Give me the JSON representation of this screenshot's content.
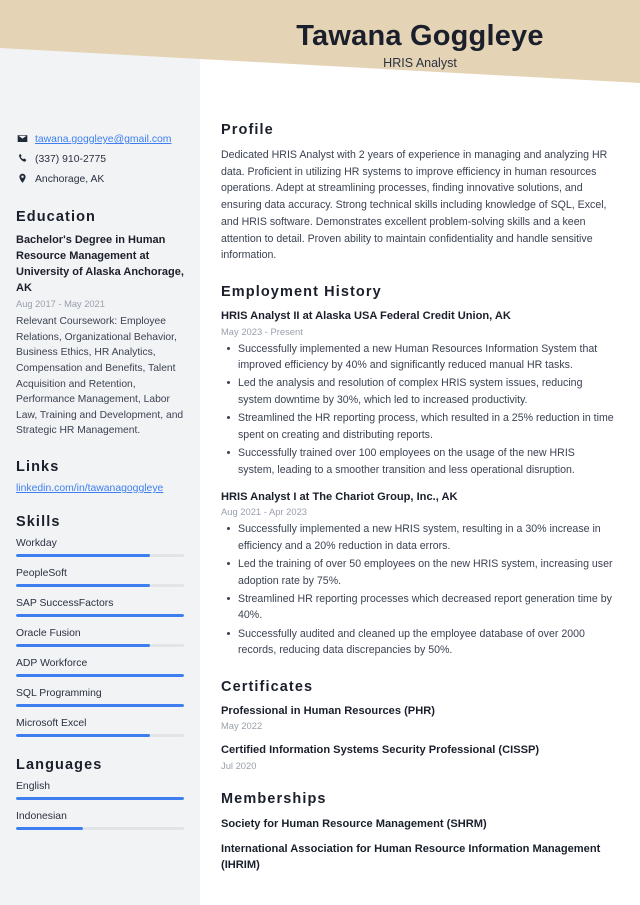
{
  "header": {
    "name": "Tawana Goggleye",
    "title": "HRIS Analyst",
    "band_color": "#e4d3b4"
  },
  "theme": {
    "accent": "#3d7ff0",
    "sidebar_bg": "#f2f3f5",
    "heading_color": "#1a1f2b",
    "muted_color": "#9aa0ab"
  },
  "sidebar": {
    "contact": [
      {
        "icon": "envelope-icon",
        "text": "tawana.goggleye@gmail.com",
        "is_link": true
      },
      {
        "icon": "phone-icon",
        "text": "(337) 910-2775",
        "is_link": false
      },
      {
        "icon": "location-pin-icon",
        "text": "Anchorage, AK",
        "is_link": false
      }
    ],
    "education": {
      "heading": "Education",
      "degree": "Bachelor's Degree in Human Resource Management at University of Alaska Anchorage, AK",
      "dates": "Aug 2017 - May 2021",
      "description": "Relevant Coursework: Employee Relations, Organizational Behavior, Business Ethics, HR Analytics, Compensation and Benefits, Talent Acquisition and Retention, Performance Management, Labor Law, Training and Development, and Strategic HR Management."
    },
    "links": {
      "heading": "Links",
      "items": [
        {
          "label": "linkedin.com/in/tawanagoggleye"
        }
      ]
    },
    "skills": {
      "heading": "Skills",
      "items": [
        {
          "label": "Workday",
          "level": 80
        },
        {
          "label": "PeopleSoft",
          "level": 80
        },
        {
          "label": "SAP SuccessFactors",
          "level": 100
        },
        {
          "label": "Oracle Fusion",
          "level": 80
        },
        {
          "label": "ADP Workforce",
          "level": 100
        },
        {
          "label": "SQL Programming",
          "level": 100
        },
        {
          "label": "Microsoft Excel",
          "level": 80
        }
      ]
    },
    "languages": {
      "heading": "Languages",
      "items": [
        {
          "label": "English",
          "level": 100
        },
        {
          "label": "Indonesian",
          "level": 40
        }
      ]
    }
  },
  "main": {
    "profile": {
      "heading": "Profile",
      "text": "Dedicated HRIS Analyst with 2 years of experience in managing and analyzing HR data. Proficient in utilizing HR systems to improve efficiency in human resources operations. Adept at streamlining processes, finding innovative solutions, and ensuring data accuracy. Strong technical skills including knowledge of SQL, Excel, and HRIS software. Demonstrates excellent problem-solving skills and a keen attention to detail. Proven ability to maintain confidentiality and handle sensitive information."
    },
    "employment": {
      "heading": "Employment History",
      "entries": [
        {
          "title": "HRIS Analyst II at Alaska USA Federal Credit Union, AK",
          "dates": "May 2023 - Present",
          "bullets": [
            "Successfully implemented a new Human Resources Information System that improved efficiency by 40% and significantly reduced manual HR tasks.",
            "Led the analysis and resolution of complex HRIS system issues, reducing system downtime by 30%, which led to increased productivity.",
            "Streamlined the HR reporting process, which resulted in a 25% reduction in time spent on creating and distributing reports.",
            "Successfully trained over 100 employees on the usage of the new HRIS system, leading to a smoother transition and less operational disruption."
          ]
        },
        {
          "title": "HRIS Analyst I at The Chariot Group, Inc., AK",
          "dates": "Aug 2021 - Apr 2023",
          "bullets": [
            "Successfully implemented a new HRIS system, resulting in a 30% increase in efficiency and a 20% reduction in data errors.",
            "Led the training of over 50 employees on the new HRIS system, increasing user adoption rate by 75%.",
            "Streamlined HR reporting processes which decreased report generation time by 40%.",
            "Successfully audited and cleaned up the employee database of over 2000 records, reducing data discrepancies by 50%."
          ]
        }
      ]
    },
    "certificates": {
      "heading": "Certificates",
      "entries": [
        {
          "title": "Professional in Human Resources (PHR)",
          "dates": "May 2022"
        },
        {
          "title": "Certified Information Systems Security Professional (CISSP)",
          "dates": "Jul 2020"
        }
      ]
    },
    "memberships": {
      "heading": "Memberships",
      "entries": [
        {
          "title": "Society for Human Resource Management (SHRM)"
        },
        {
          "title": "International Association for Human Resource Information Management (IHRIM)"
        }
      ]
    }
  }
}
